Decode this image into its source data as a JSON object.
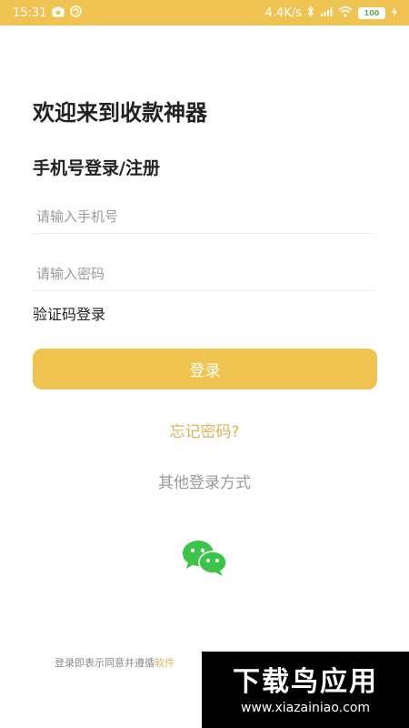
{
  "status_bar": {
    "time": "15:31",
    "network_speed": "4.4K/s",
    "battery": "100",
    "icons": [
      "camera-icon",
      "sync-icon",
      "bluetooth-icon",
      "sim-icon",
      "wifi-icon",
      "battery-icon",
      "charging-icon"
    ],
    "background_color": "#efc351"
  },
  "page": {
    "welcome_title": "欢迎来到收款神器",
    "subtitle": "手机号登录/注册"
  },
  "form": {
    "phone_placeholder": "请输入手机号",
    "password_placeholder": "请输入密码",
    "sms_login_label": "验证码登录",
    "login_button_label": "登录",
    "login_button_color": "#eec350"
  },
  "links": {
    "forgot_password": "忘记密码?",
    "other_login": "其他登录方式"
  },
  "social": {
    "wechat_icon": "wechat-icon",
    "wechat_color": "#3cc34a"
  },
  "footer": {
    "agreement_text": "登录即表示同意并遵循",
    "agreement_link": "软件"
  },
  "watermark": {
    "title": "下载鸟应用",
    "url": "www.xiazainiao.com"
  }
}
